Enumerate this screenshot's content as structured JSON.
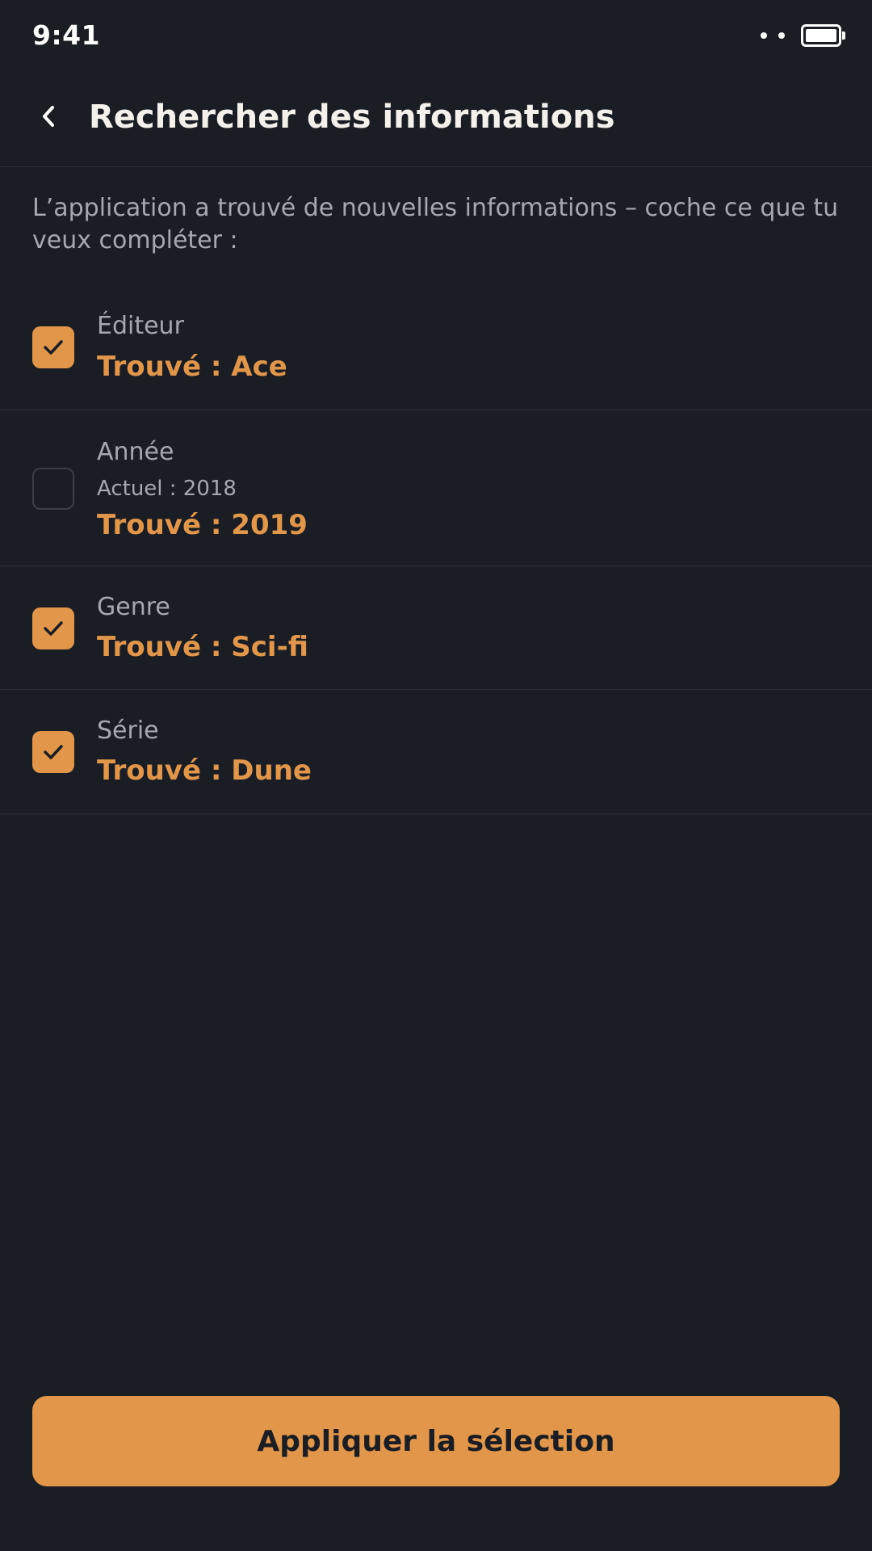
{
  "status_bar": {
    "time": "9:41"
  },
  "header": {
    "title": "Rechercher des informations",
    "back_icon": "chevron-left-icon"
  },
  "intro": "L’application a trouvé de nouvelles informations – coche ce que tu veux compléter :",
  "fields": [
    {
      "label": "Éditeur",
      "current": "",
      "found": "Trouvé : Ace",
      "checked": true
    },
    {
      "label": "Année",
      "current": "Actuel : 2018",
      "found": "Trouvé : 2019",
      "checked": false
    },
    {
      "label": "Genre",
      "current": "",
      "found": "Trouvé : Sci-fi",
      "checked": true
    },
    {
      "label": "Série",
      "current": "",
      "found": "Trouvé : Dune",
      "checked": true
    }
  ],
  "apply_button": "Appliquer la sélection",
  "colors": {
    "background": "#1b1d24",
    "accent": "#e2964a",
    "muted_text": "#a5a8b1",
    "divider": "#2f323b"
  }
}
